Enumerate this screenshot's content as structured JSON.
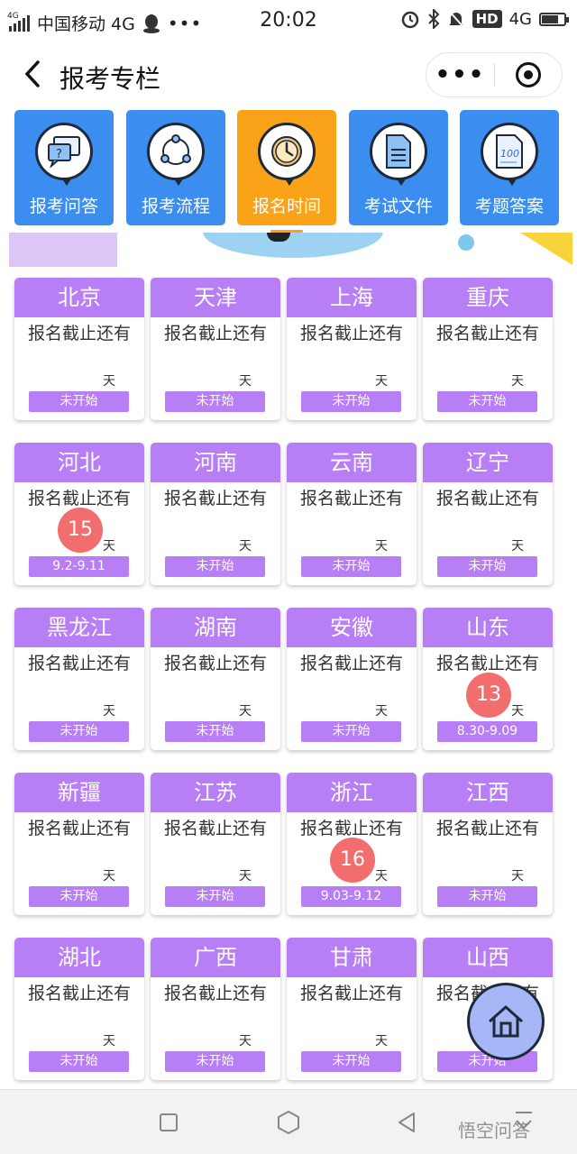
{
  "status_bar": {
    "network_small": "4G",
    "carrier": "中国移动 4G",
    "time": "20:02",
    "hd": "HD",
    "network": "4G"
  },
  "nav": {
    "title": "报考专栏",
    "more": "•••"
  },
  "tabs": [
    {
      "label": "报考问答",
      "icon": "chat-question-icon",
      "active": false
    },
    {
      "label": "报考流程",
      "icon": "share-flow-icon",
      "active": false
    },
    {
      "label": "报名时间",
      "icon": "clock-icon",
      "active": true
    },
    {
      "label": "考试文件",
      "icon": "document-icon",
      "active": false
    },
    {
      "label": "考题答案",
      "icon": "answer-sheet-icon",
      "active": false
    }
  ],
  "card_subtitle": "报名截止还有",
  "day_unit": "天",
  "cards": [
    {
      "province": "北京",
      "count": "",
      "badge": "未开始"
    },
    {
      "province": "天津",
      "count": "",
      "badge": "未开始"
    },
    {
      "province": "上海",
      "count": "",
      "badge": "未开始"
    },
    {
      "province": "重庆",
      "count": "",
      "badge": "未开始"
    },
    {
      "province": "河北",
      "count": "15",
      "badge": "9.2-9.11"
    },
    {
      "province": "河南",
      "count": "",
      "badge": "未开始"
    },
    {
      "province": "云南",
      "count": "",
      "badge": "未开始"
    },
    {
      "province": "辽宁",
      "count": "",
      "badge": "未开始"
    },
    {
      "province": "黑龙江",
      "count": "",
      "badge": "未开始"
    },
    {
      "province": "湖南",
      "count": "",
      "badge": "未开始"
    },
    {
      "province": "安徽",
      "count": "",
      "badge": "未开始"
    },
    {
      "province": "山东",
      "count": "13",
      "badge": "8.30-9.09"
    },
    {
      "province": "新疆",
      "count": "",
      "badge": "未开始"
    },
    {
      "province": "江苏",
      "count": "",
      "badge": "未开始"
    },
    {
      "province": "浙江",
      "count": "16",
      "badge": "9.03-9.12"
    },
    {
      "province": "江西",
      "count": "",
      "badge": "未开始"
    },
    {
      "province": "湖北",
      "count": "",
      "badge": "未开始"
    },
    {
      "province": "广西",
      "count": "",
      "badge": "未开始"
    },
    {
      "province": "甘肃",
      "count": "",
      "badge": "未开始"
    },
    {
      "province": "山西",
      "count": "",
      "badge": "未开始"
    }
  ],
  "colors": {
    "tab_blue": "#3b8ef0",
    "tab_active": "#fba318",
    "card_purple": "#b77ef5",
    "count_red": "#f26d6d",
    "fab_blue": "#a6b6f6"
  },
  "watermark": "悟空问答"
}
